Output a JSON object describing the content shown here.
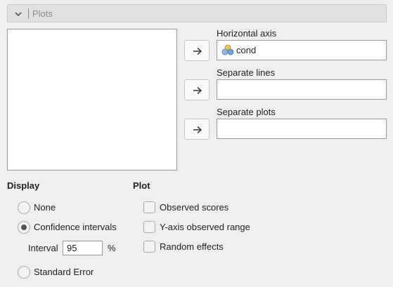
{
  "panel": {
    "title": "Plots",
    "collapse_icon": "chevron-down-icon"
  },
  "variables_list": {
    "items": []
  },
  "targets": {
    "horizontal_axis": {
      "label": "Horizontal axis",
      "value": "cond",
      "icon": "nominal-variable-icon",
      "button_icon": "arrow-right-icon"
    },
    "separate_lines": {
      "label": "Separate lines",
      "value": "",
      "button_icon": "arrow-right-icon"
    },
    "separate_plots": {
      "label": "Separate plots",
      "value": "",
      "button_icon": "arrow-right-icon"
    }
  },
  "display": {
    "title": "Display",
    "options": [
      {
        "label": "None",
        "selected": false
      },
      {
        "label": "Confidence intervals",
        "selected": true
      },
      {
        "label": "Standard Error",
        "selected": false
      }
    ],
    "interval_label": "Interval",
    "interval_value": "95",
    "interval_unit": "%"
  },
  "plot": {
    "title": "Plot",
    "checkboxes": [
      {
        "label": "Observed scores",
        "checked": false
      },
      {
        "label": "Y-axis observed range",
        "checked": false
      },
      {
        "label": "Random effects",
        "checked": false
      }
    ]
  },
  "colors": {
    "variable_icon_yellow": "#f5c242",
    "variable_icon_blue": "#6fa3e8",
    "radio_selected_dot": "#555555"
  }
}
